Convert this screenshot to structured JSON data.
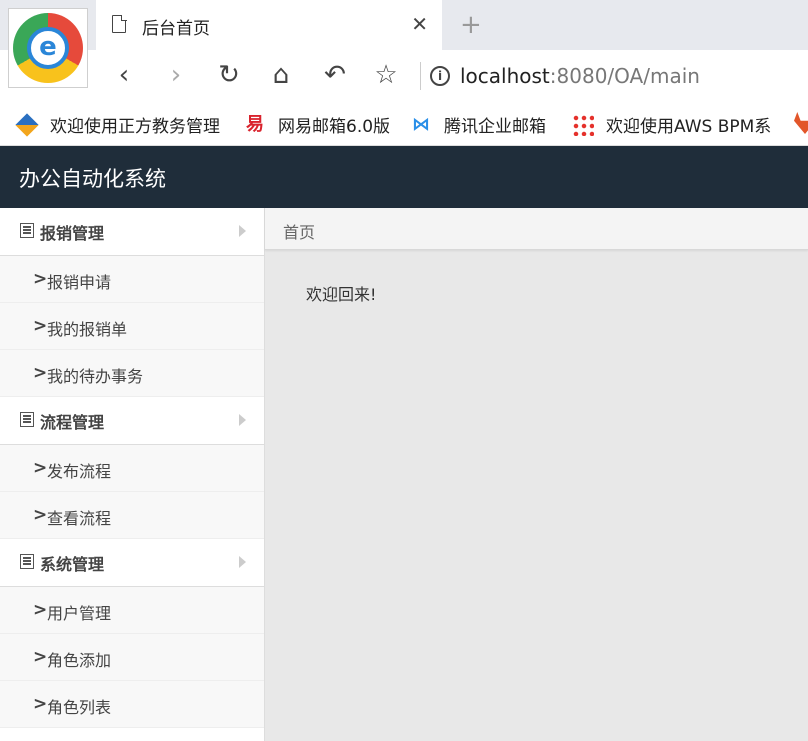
{
  "browser": {
    "tab_title": "后台首页",
    "url_host": "localhost",
    "url_rest": ":8080/OA/main",
    "bookmarks": [
      {
        "label": "欢迎使用正方教务管理",
        "icon": "zf-icon"
      },
      {
        "label": "网易邮箱6.0版",
        "icon": "netease-mail-icon"
      },
      {
        "label": "腾讯企业邮箱",
        "icon": "tencent-mail-icon"
      },
      {
        "label": "欢迎使用AWS BPM系",
        "icon": "aws-bpm-icon"
      }
    ]
  },
  "app": {
    "brand": "办公自动化系统"
  },
  "sidebar": {
    "groups": [
      {
        "label": "报销管理",
        "items": [
          "报销申请",
          "我的报销单",
          "我的待办事务"
        ]
      },
      {
        "label": "流程管理",
        "items": [
          "发布流程",
          "查看流程"
        ]
      },
      {
        "label": "系统管理",
        "items": [
          "用户管理",
          "角色添加",
          "角色列表"
        ]
      }
    ]
  },
  "main": {
    "breadcrumb": "首页",
    "welcome": "欢迎回来!"
  }
}
